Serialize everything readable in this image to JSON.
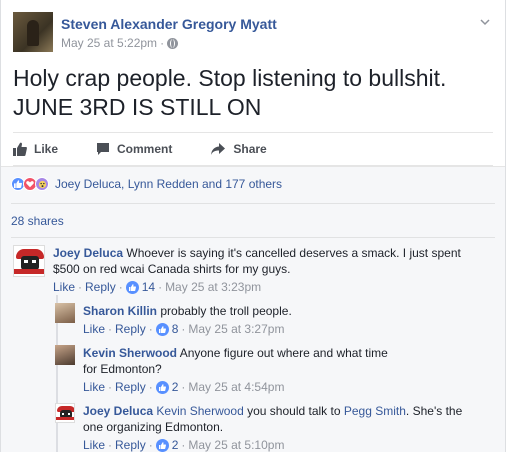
{
  "post": {
    "author": "Steven Alexander Gregory Myatt",
    "timestamp": "May 25 at 5:22pm",
    "separator": "·",
    "privacy_icon": "globe-icon",
    "menu_icon": "chevron-down-icon",
    "text_line1": "Holy crap people. Stop listening to bullshit.",
    "text_line2": "JUNE 3RD IS STILL ON"
  },
  "actions": {
    "like_label": "Like",
    "comment_label": "Comment",
    "share_label": "Share",
    "like_icon": "thumbs-up-icon",
    "comment_icon": "speech-bubble-icon",
    "share_icon": "share-arrow-icon"
  },
  "reactions": {
    "icons": [
      "like-reaction-icon",
      "love-reaction-icon",
      "wow-reaction-icon"
    ],
    "summary": "Joey Deluca, Lynn Redden and 177 others"
  },
  "shares": "28 shares",
  "comments": [
    {
      "name": "Joey Deluca",
      "text": "Whoever is saying it's cancelled deserves a smack. I just spent $500 on red wcai Canada shirts for my guys.",
      "like": "Like",
      "reply": "Reply",
      "likes": "14",
      "time": "May 25 at 3:23pm"
    }
  ],
  "replies": [
    {
      "name": "Sharon Killin",
      "text": "probably the troll people.",
      "like": "Like",
      "reply": "Reply",
      "likes": "8",
      "time": "May 25 at 3:27pm"
    },
    {
      "name": "Kevin Sherwood",
      "text": "Anyone figure out where and what time for Edmonton?",
      "like": "Like",
      "reply": "Reply",
      "likes": "2",
      "time": "May 25 at 4:54pm"
    },
    {
      "name": "Joey Deluca",
      "mention1": "Kevin Sherwood",
      "text_mid": "you should talk to",
      "mention2": "Pegg Smith",
      "text_end": ". She's the one organizing Edmonton.",
      "like": "Like",
      "reply": "Reply",
      "likes": "2",
      "time": "May 25 at 5:10pm"
    }
  ],
  "colors": {
    "link": "#365899",
    "meta": "#90949c",
    "like_blue": "#5890ff",
    "love_red": "#f25268",
    "wow_purple": "#a787e6"
  }
}
